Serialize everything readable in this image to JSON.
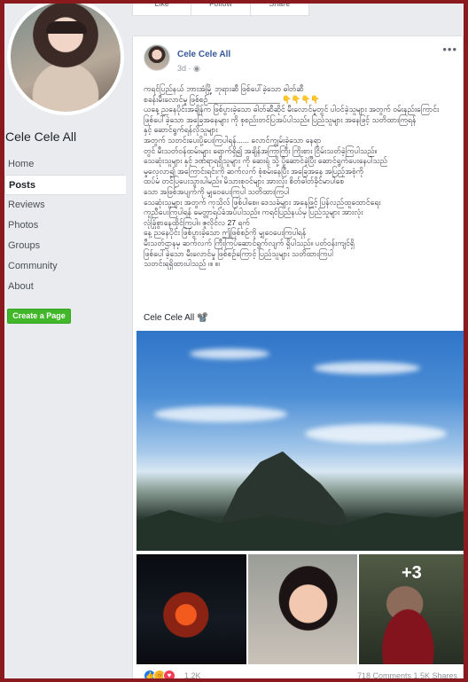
{
  "page": {
    "name": "Cele Cele All",
    "nav": [
      "Home",
      "Posts",
      "Reviews",
      "Photos",
      "Groups",
      "Community",
      "About"
    ],
    "active_nav": "Posts",
    "create_button": "Create a Page"
  },
  "top_card": {
    "actions": [
      "Like",
      "Follow",
      "Share"
    ]
  },
  "post": {
    "author": "Cele Cele All",
    "time": "3d",
    "privacy_icon": "globe-icon",
    "more_icon": "more-options-icon",
    "body": "ကရင်ပြည်နယ် ဘားအံမြို့ ဘုရားဆီ ဖြစ်ပေါ်ခဲ့သော ဓါတ်ဆီ\nစခန်းမီးလောင်မှု ဖြစ်စဉ်_________________ 👇👇👇👇\nယနေ့ ညနေပိုင်းအချိန်က ဖြစ်ပွားခဲ့သော ဓါတ်ဆီဆိုင် မီးလောင်မှုတွင် ပါဝင်ခဲ့သူများ အတွက် ဝမ်းနည်းကြောင်း\nဖြစ်ပေါ်ခဲ့သော အခြေအနေများ ကို စုစည်းတင်ပြအပ်ပါသည်။ ပြည်သူများ အနေဖြင့် သတိထားကြရန်\nနှင့် ဆောင်ရွက်ရန်လိုသူများ\nအတွက် သတင်းပေးပို့ပေးကြပါရန်...... လောင်ကျွမ်းခဲ့သော နေရာ\nတွင် မီးသတ်ဝန်ထမ်းများ ရောက်ရှိ၍ အချိန်အကြာကြီး ကြိုးစား ငြိမ်းသတ်ခဲ့ကြပါသည်။\nသေဆုံးသူများ နှင့် ဒဏ်ရာရရှိသူများ ကို ဆေးရုံ သို့ ပို့ဆောင်ခဲ့ပြီး ဆောင်ရွက်ပေးနေပါသည်\nမှုလေ့လာ၍ အကြောင်းရင်းကို ဆက်လက် စုံစမ်းနေပြီး အခြေအနေ အပြည့်အစုံကို\nထပ်မံ တင်ပြပေးသွားပါမည်။ မိသားစုဝင်များ အားလုံး စိတ်ဓါတ်ခိုင်မာပါစေ\nသော အဖြစ်အပျက်ကို မျှဝေပေးကြပါ သတိထားကြပါ\nသေဆုံးသူများ အတွက် ကုသိုလ် ဖြစ်ပါစေ။ ဒေသခံများ အနေဖြင့် ပြန်လည်ထူထောင်ရေး\nကူညီပေးကြပါရန် မေတ္တာရပ်ခံအပ်ပါသည်။ ကရင်ပြည်နယ်မှ ပြည်သူများ အားလုံး\nလုံခြုံစွာနေထိုင်ကြပါ။ ဇူလိုင်လ 27 ရက်\nနေ့ ညနေပိုင်း ဖြစ်ပွားခဲ့သော ဤဖြစ်စဉ်ကို မျှဝေပေးကြပါရန်\nမီးသတ်ဌာနမှ ဆက်လက် ကြီးကြပ်ဆောင်ရွက်လျက် ရှိပါသည်။ ပတ်ဝန်းကျင်ရှိ\nဖြစ်ပေါ်ခဲ့သော မီးလောင်မှု ဖြစ်စဉ်ကြောင့် ပြည်သူများ သတိထားကြပါ\nသတင်းရရှိထားပါသည် ။။ ။။",
    "signature": "Cele Cele All 📽️",
    "more_photos_count": "+3",
    "reaction_count": "1.2K",
    "comments_shares": "718 Comments  1.5K Shares"
  }
}
